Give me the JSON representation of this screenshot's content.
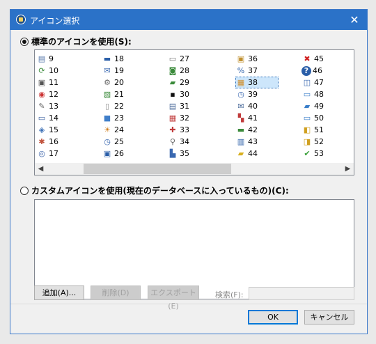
{
  "window": {
    "title": "アイコン選択",
    "close_glyph": "✕"
  },
  "standard_radio": {
    "label": "標準のアイコンを使用(S):",
    "checked": true
  },
  "custom_radio": {
    "label": "カスタムアイコンを使用(現在のデータベースに入っているもの)(C):",
    "checked": false
  },
  "icon_columns": [
    [
      {
        "num": "9",
        "icon": "id-card-icon",
        "glyph": "▤",
        "color": "#5577aa"
      },
      {
        "num": "10",
        "icon": "refresh-icon",
        "glyph": "⟳",
        "color": "#3a8a3a"
      },
      {
        "num": "11",
        "icon": "safe-icon",
        "glyph": "▣",
        "color": "#555555"
      },
      {
        "num": "12",
        "icon": "lifebuoy-icon",
        "glyph": "◉",
        "color": "#cc3333"
      },
      {
        "num": "13",
        "icon": "tools-icon",
        "glyph": "✎",
        "color": "#666666"
      },
      {
        "num": "14",
        "icon": "drive-icon",
        "glyph": "▭",
        "color": "#3a5fa0"
      },
      {
        "num": "15",
        "icon": "book-icon",
        "glyph": "◈",
        "color": "#3b6fb5"
      },
      {
        "num": "16",
        "icon": "network-icon",
        "glyph": "✱",
        "color": "#c0503a"
      },
      {
        "num": "17",
        "icon": "disc-icon",
        "glyph": "◎",
        "color": "#3a62a8"
      }
    ],
    [
      {
        "num": "18",
        "icon": "monitor-icon",
        "glyph": "▬",
        "color": "#2a5ea8"
      },
      {
        "num": "19",
        "icon": "mail-icon",
        "glyph": "✉",
        "color": "#3a68b0"
      },
      {
        "num": "20",
        "icon": "gear-icon",
        "glyph": "⚙",
        "color": "#666666"
      },
      {
        "num": "21",
        "icon": "clipboard-icon",
        "glyph": "▧",
        "color": "#3a8a3a"
      },
      {
        "num": "22",
        "icon": "document-icon",
        "glyph": "▯",
        "color": "#888888"
      },
      {
        "num": "23",
        "icon": "desktop-icon",
        "glyph": "■",
        "color": "#3f7ec9"
      },
      {
        "num": "24",
        "icon": "sun-icon",
        "glyph": "☀",
        "color": "#d08020"
      },
      {
        "num": "25",
        "icon": "clock-icon",
        "glyph": "◷",
        "color": "#3a68b0"
      },
      {
        "num": "26",
        "icon": "floppy-icon",
        "glyph": "▣",
        "color": "#2a5ea8"
      }
    ],
    [
      {
        "num": "27",
        "icon": "printer-icon",
        "glyph": "▭",
        "color": "#777777"
      },
      {
        "num": "28",
        "icon": "network-drive-icon",
        "glyph": "◙",
        "color": "#3a8a3a"
      },
      {
        "num": "29",
        "icon": "folder-open-icon",
        "glyph": "▰",
        "color": "#3a8a3a"
      },
      {
        "num": "30",
        "icon": "terminal-icon",
        "glyph": "▪",
        "color": "#111111"
      },
      {
        "num": "31",
        "icon": "printer-icon",
        "glyph": "▤",
        "color": "#4a6a9a"
      },
      {
        "num": "32",
        "icon": "grid-icon",
        "glyph": "▦",
        "color": "#c03a3a"
      },
      {
        "num": "33",
        "icon": "pinwheel-icon",
        "glyph": "✚",
        "color": "#c03a3a"
      },
      {
        "num": "34",
        "icon": "wrench-icon",
        "glyph": "⚲",
        "color": "#666666"
      },
      {
        "num": "35",
        "icon": "workstation-icon",
        "glyph": "▙",
        "color": "#3a68b0"
      }
    ],
    [
      {
        "num": "36",
        "icon": "package-icon",
        "glyph": "▣",
        "color": "#c09030"
      },
      {
        "num": "37",
        "icon": "percent-icon",
        "glyph": "%",
        "color": "#2a5ea8"
      },
      {
        "num": "38",
        "icon": "calendar-icon",
        "glyph": "▦",
        "color": "#d09030"
      },
      {
        "num": "39",
        "icon": "clock-icon",
        "glyph": "◷",
        "color": "#3a68b0"
      },
      {
        "num": "40",
        "icon": "mail-open-icon",
        "glyph": "✉",
        "color": "#4a6a9a"
      },
      {
        "num": "41",
        "icon": "chart-doc-icon",
        "glyph": "▚",
        "color": "#c03a3a"
      },
      {
        "num": "42",
        "icon": "battery-icon",
        "glyph": "▬",
        "color": "#3a8a3a"
      },
      {
        "num": "43",
        "icon": "database-icon",
        "glyph": "▥",
        "color": "#2a5ea8"
      },
      {
        "num": "44",
        "icon": "note-icon",
        "glyph": "▰",
        "color": "#d8b020"
      }
    ],
    [
      {
        "num": "45",
        "icon": "close-icon",
        "glyph": "✖",
        "color": "#d02020"
      },
      {
        "num": "46",
        "icon": "help-icon",
        "glyph": "?",
        "color": "#ffffff"
      },
      {
        "num": "47",
        "icon": "book-icon",
        "glyph": "◫",
        "color": "#3a68b0"
      },
      {
        "num": "48",
        "icon": "folder-icon",
        "glyph": "▭",
        "color": "#3a7ec9"
      },
      {
        "num": "49",
        "icon": "folder-open-icon",
        "glyph": "▰",
        "color": "#3a7ec9"
      },
      {
        "num": "50",
        "icon": "folder-search-icon",
        "glyph": "▭",
        "color": "#3a7ec9"
      },
      {
        "num": "51",
        "icon": "lock-open-icon",
        "glyph": "◧",
        "color": "#d0a020"
      },
      {
        "num": "52",
        "icon": "lock-icon",
        "glyph": "◨",
        "color": "#d0a020"
      },
      {
        "num": "53",
        "icon": "checkmark-icon",
        "glyph": "✔",
        "color": "#3aa03a"
      }
    ]
  ],
  "selected_icon": "38",
  "scroll": {
    "left": "◀",
    "right": "▶"
  },
  "buttons": {
    "add": "追加(A)...",
    "delete": "削除(D)",
    "export": "エクスポート(E)",
    "ok": "OK",
    "cancel": "キャンセル"
  },
  "search": {
    "label": "検索(F):",
    "value": ""
  }
}
